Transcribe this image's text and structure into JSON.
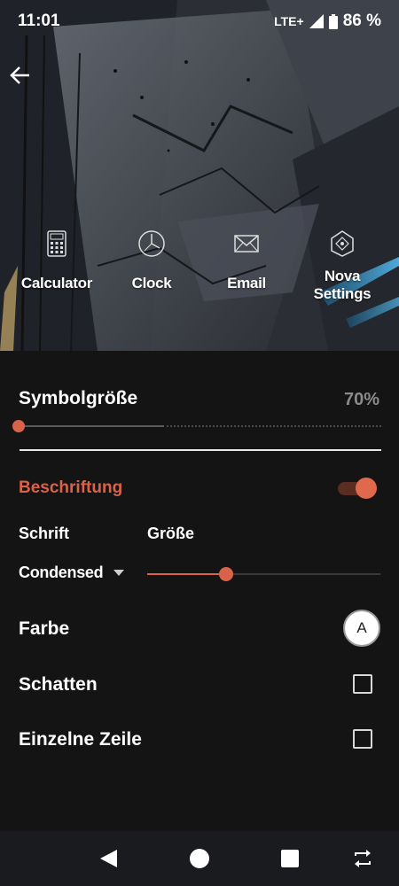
{
  "status_bar": {
    "time": "11:01",
    "network": "LTE+",
    "battery": "86 %"
  },
  "preview": {
    "apps": [
      {
        "label": "Calculator",
        "icon": "calculator-icon"
      },
      {
        "label": "Clock",
        "icon": "clock-icon"
      },
      {
        "label": "Email",
        "icon": "email-icon"
      },
      {
        "label": "Nova Settings",
        "icon": "nova-settings-icon"
      }
    ]
  },
  "settings": {
    "icon_size": {
      "title": "Symbolgröße",
      "value": "70%",
      "slider_fraction": 0.0
    },
    "label_section": {
      "title": "Beschriftung",
      "enabled": true
    },
    "font": {
      "label": "Schrift",
      "value": "Condensed"
    },
    "size": {
      "label": "Größe",
      "slider_fraction": 0.34
    },
    "color": {
      "label": "Farbe",
      "swatch_letter": "A",
      "swatch_color": "#ffffff"
    },
    "shadow": {
      "label": "Schatten",
      "checked": false
    },
    "single_line": {
      "label": "Einzelne Zeile",
      "checked": false
    }
  },
  "colors": {
    "accent": "#d9634a",
    "background": "#141414",
    "navbar": "#1a1b1f"
  }
}
